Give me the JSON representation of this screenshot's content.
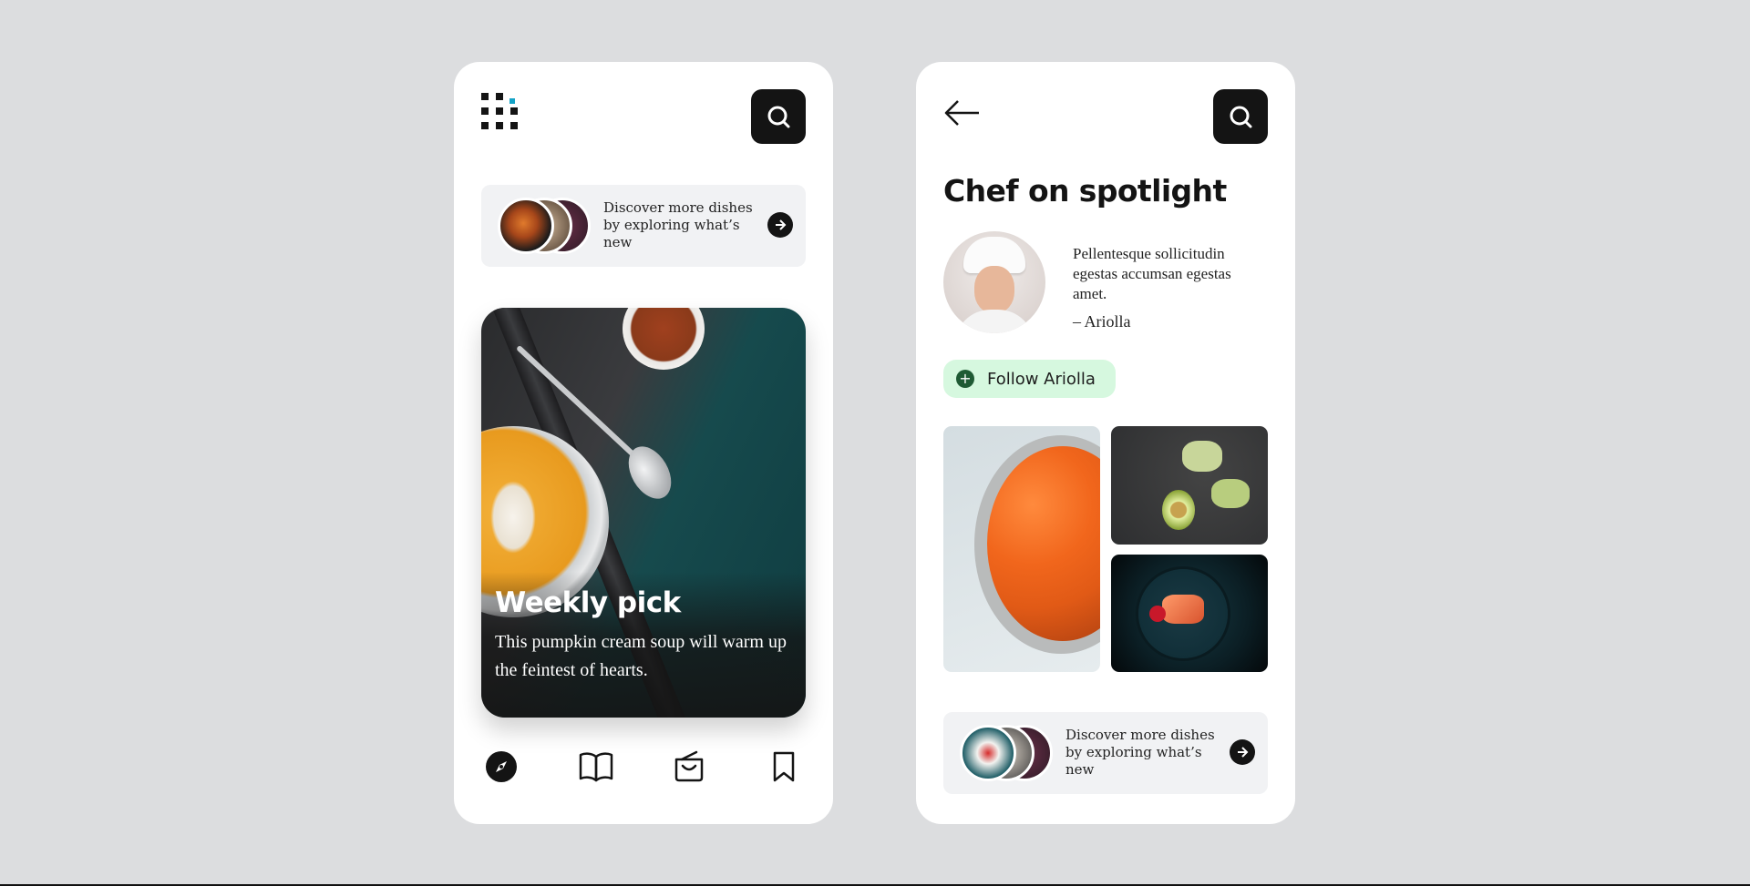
{
  "left_screen": {
    "discover": {
      "text": "Discover more dishes by exploring what’s new"
    },
    "featured": {
      "title": "Weekly pick",
      "description": "This pumpkin cream soup will warm up the feintest of hearts."
    },
    "bottom_nav": {
      "items": [
        {
          "name": "explore",
          "icon": "compass-icon",
          "active": true
        },
        {
          "name": "recipes",
          "icon": "book-open-icon",
          "active": false
        },
        {
          "name": "shop",
          "icon": "shopping-bag-icon",
          "active": false
        },
        {
          "name": "saved",
          "icon": "bookmark-icon",
          "active": false
        }
      ]
    }
  },
  "right_screen": {
    "title": "Chef on spotlight",
    "chef": {
      "quote": "Pellentesque sollicitudin egestas accumsan egestas amet.",
      "author": "– Ariolla"
    },
    "follow_button": {
      "label": "Follow Ariolla",
      "icon": "plus-icon"
    },
    "gallery": [
      {
        "name": "carrot-salad-photo"
      },
      {
        "name": "avocado-toast-photo"
      },
      {
        "name": "salmon-plate-photo"
      }
    ],
    "discover": {
      "text": "Discover more dishes by exploring what’s new"
    }
  },
  "colors": {
    "background": "#dcdddf",
    "card": "#ffffff",
    "primary_dark": "#141414",
    "accent_teal": "#14a3c7",
    "follow_bg": "#d6f8df",
    "follow_icon": "#1f5a34",
    "discover_bg": "#f1f2f4"
  }
}
